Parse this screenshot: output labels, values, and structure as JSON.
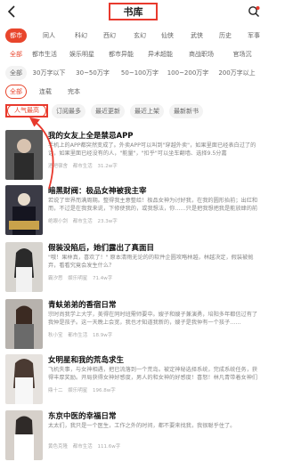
{
  "header": {
    "title": "书库",
    "back_icon": "chevron-left-icon",
    "search_icon": "search-icon",
    "accent": "#e8392d"
  },
  "filters": {
    "row1": [
      "都市",
      "同人",
      "科幻",
      "西幻",
      "玄幻",
      "仙侠",
      "武侠",
      "历史",
      "军事"
    ],
    "row2": [
      "全部",
      "都市生活",
      "娱乐明星",
      "都市异能",
      "异术超能",
      "商战职场",
      "官场沉"
    ],
    "row3": [
      "全部",
      "30万字以下",
      "30~50万字",
      "50~100万字",
      "100~200万字",
      "200万字以上"
    ],
    "row4": [
      "全部",
      "连载",
      "完本"
    ],
    "row5": [
      "人气最高",
      "订阅最多",
      "最近更新",
      "最近上架",
      "最新新书"
    ]
  },
  "books": [
    {
      "title": "我的女友上全是禁忌APP",
      "desc": "手机上的APP都突然变成了。外卖APP可以叫到\"穿越外卖\"，如果里面已经表白过了的话，如果里面已经没有的人，\"能量\"，\"扣乎\"可以坐车翻墙、选择9.5分嘉",
      "author": "酒吧宿舍",
      "category": "都市生活",
      "words": "31.2w字"
    },
    {
      "title": "暗黑财阀：极品女神被我主宰",
      "desc": "若说了世界而满周期。整得我主意整给！极品女神为讨好我，在我的圆形抬前；出红和而，不过是在我我来说，下修使我的，或我想法，你……只是把我想把我是能放肆的前",
      "author": "绝眼小剑",
      "category": "都市生活",
      "words": "23.3w字"
    },
    {
      "title": "假装没陷后，她们露出了真面目",
      "desc": "\"哦！果林真，喜欢了！\" 原本清雨无论的的软件企圆攻略林越，林越决定，假装被抛弃，看看究竟会发生什么？",
      "author": "霸汐思",
      "category": "娱乐明星",
      "words": "71.4w字"
    },
    {
      "title": "青蚨弟弟的香宿日常",
      "desc": "宗时尚我学上大学，美得在同时班需师要中。嫂子和嫂子兼演勇，培阳多年都信过有了我仲是孩子。这一天晚上会宽，我也才知道我新的，嫂子是我仲有一个孩子……",
      "author": "秋小宝",
      "category": "都市生活",
      "words": "18.9w字"
    },
    {
      "title": "女明星和我的荒岛求生",
      "desc": "飞机失事，与女神相遇，把已流落到一个荒岛。被定神秘选择系统，完成系统任务，获得丰厚奖励。开局获得女神好感度，男人的和女神的好感度！喜怒！林凡青带着女神们开启了荒……",
      "author": "鼎十二",
      "category": "娱乐明星",
      "words": "196.8w字"
    },
    {
      "title": "东京中医的幸福日常",
      "desc": "太太们，我只是一个医生，工作之外的时间，都不要来找我，我很聪乎住了。",
      "author": "黄色克隆",
      "category": "都市生活",
      "words": "111.6w字"
    }
  ]
}
